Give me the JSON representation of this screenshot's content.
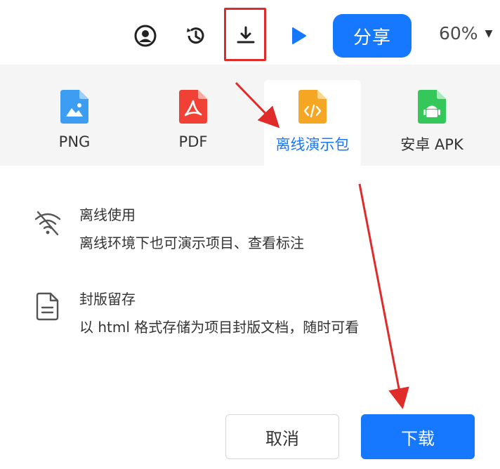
{
  "toolbar": {
    "share_label": "分享",
    "zoom_value": "60%"
  },
  "export_tabs": [
    {
      "label": "PNG"
    },
    {
      "label": "PDF"
    },
    {
      "label": "离线演示包"
    },
    {
      "label": "安卓 APK"
    }
  ],
  "features": [
    {
      "title": "离线使用",
      "description": "离线环境下也可演示项目、查看标注"
    },
    {
      "title": "封版留存",
      "description": "以 html 格式存储为项目封版文档，随时可看"
    }
  ],
  "actions": {
    "cancel_label": "取消",
    "download_label": "下载"
  },
  "colors": {
    "accent": "#1677ff",
    "annotation_red": "#e02b2b",
    "png_icon": "#3d9df3",
    "pdf_icon": "#f04134",
    "offline_icon": "#f5a623",
    "apk_icon": "#34c759"
  }
}
